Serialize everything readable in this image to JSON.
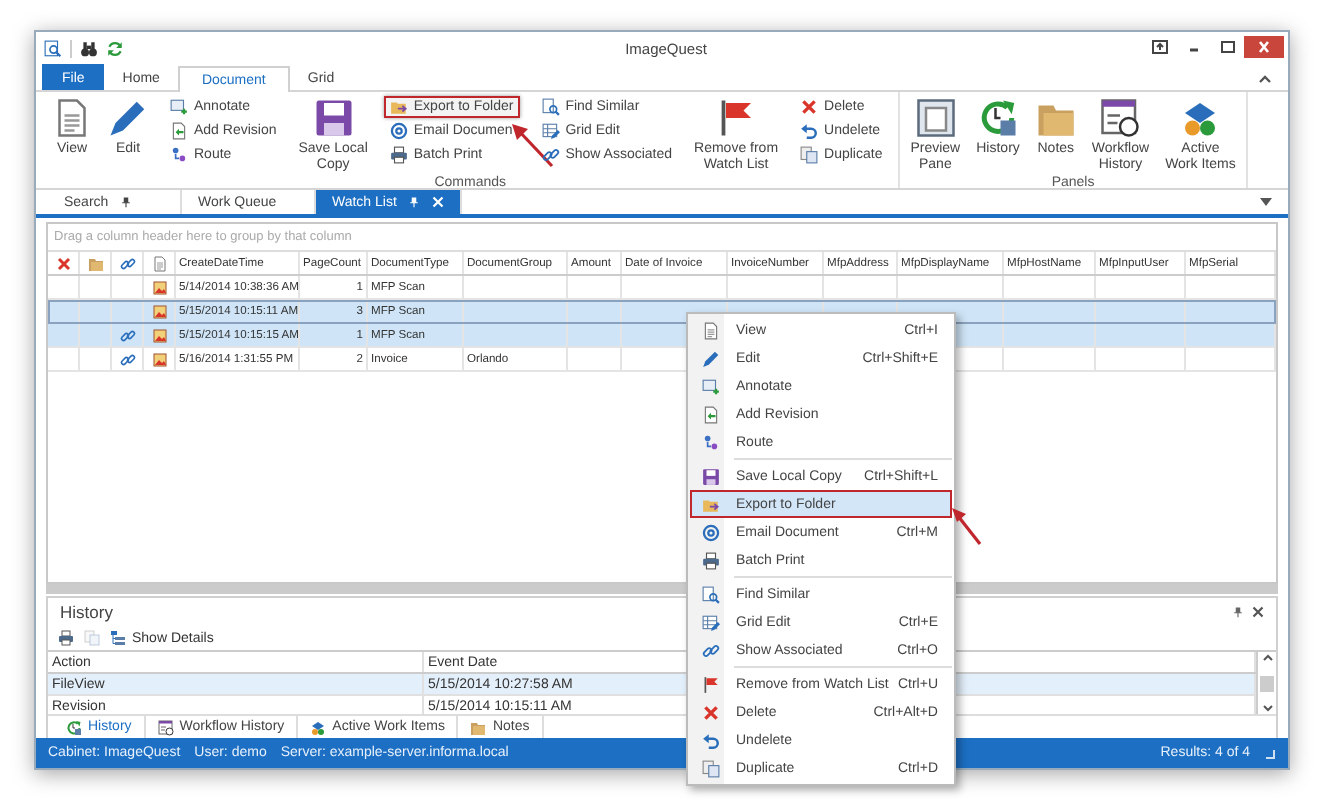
{
  "window": {
    "title": "ImageQuest"
  },
  "ribbon": {
    "tabs": [
      {
        "label": "File",
        "kind": "file",
        "selected": false
      },
      {
        "label": "Home",
        "kind": "page",
        "selected": false
      },
      {
        "label": "Document",
        "kind": "page",
        "selected": true
      },
      {
        "label": "Grid",
        "kind": "page",
        "selected": false
      }
    ],
    "groups": [
      {
        "label": "Commands",
        "items": [
          {
            "kind": "large",
            "label": "View"
          },
          {
            "kind": "large",
            "label": "Edit"
          },
          {
            "kind": "stack",
            "buttons": [
              {
                "label": "Annotate",
                "callout": false
              },
              {
                "label": "Add Revision",
                "callout": false
              },
              {
                "label": "Route",
                "callout": false
              }
            ]
          },
          {
            "kind": "large",
            "label": "Save Local\nCopy"
          },
          {
            "kind": "stack",
            "buttons": [
              {
                "label": "Export to Folder",
                "callout": true
              },
              {
                "label": "Email Documen",
                "callout": false
              },
              {
                "label": "Batch Print",
                "callout": false
              }
            ]
          },
          {
            "kind": "stack",
            "buttons": [
              {
                "label": "Find Similar",
                "callout": false
              },
              {
                "label": "Grid Edit",
                "callout": false
              },
              {
                "label": "Show Associated",
                "callout": false
              }
            ]
          },
          {
            "kind": "large",
            "label": "Remove from\nWatch List"
          },
          {
            "kind": "stack",
            "buttons": [
              {
                "label": "Delete",
                "callout": false
              },
              {
                "label": "Undelete",
                "callout": false
              },
              {
                "label": "Duplicate",
                "callout": false
              }
            ]
          }
        ]
      },
      {
        "label": "Panels",
        "items": [
          {
            "kind": "large",
            "label": "Preview\nPane"
          },
          {
            "kind": "large",
            "label": "History"
          },
          {
            "kind": "large",
            "label": "Notes"
          },
          {
            "kind": "large",
            "label": "Workflow\nHistory"
          },
          {
            "kind": "large",
            "label": "Active\nWork Items"
          }
        ]
      }
    ]
  },
  "doc_tabs": [
    {
      "label": "Search",
      "selected": false,
      "pinned": true
    },
    {
      "label": "Work Queue",
      "selected": false,
      "pinned": false
    },
    {
      "label": "Watch List",
      "selected": true,
      "pinned": true
    }
  ],
  "grid": {
    "group_hint": "Drag a column header here to group by that column",
    "columns": [
      {
        "kind": "icon"
      },
      {
        "kind": "icon"
      },
      {
        "kind": "icon"
      },
      {
        "kind": "icon"
      },
      {
        "kind": "text",
        "label": "CreateDateTime"
      },
      {
        "kind": "text",
        "label": "PageCount"
      },
      {
        "kind": "text",
        "label": "DocumentType"
      },
      {
        "kind": "text",
        "label": "DocumentGroup"
      },
      {
        "kind": "text",
        "label": "Amount"
      },
      {
        "kind": "text",
        "label": "Date of Invoice"
      },
      {
        "kind": "text",
        "label": "InvoiceNumber"
      },
      {
        "kind": "text",
        "label": "MfpAddress"
      },
      {
        "kind": "text",
        "label": "MfpDisplayName"
      },
      {
        "kind": "text",
        "label": "MfpHostName"
      },
      {
        "kind": "text",
        "label": "MfpInputUser"
      },
      {
        "kind": "text",
        "label": "MfpSerial"
      }
    ],
    "rows": [
      {
        "selected": false,
        "focused": false,
        "linked": false,
        "cells": [
          "5/14/2014 10:38:36 AM",
          "1",
          "MFP Scan"
        ]
      },
      {
        "selected": true,
        "focused": true,
        "linked": false,
        "cells": [
          "5/15/2014 10:15:11 AM",
          "3",
          "MFP Scan"
        ]
      },
      {
        "selected": true,
        "focused": false,
        "linked": true,
        "cells": [
          "5/15/2014 10:15:15 AM",
          "1",
          "MFP Scan"
        ]
      },
      {
        "selected": false,
        "focused": false,
        "linked": true,
        "cells": [
          "5/16/2014 1:31:55 PM",
          "2",
          "Invoice",
          "Orlando"
        ]
      }
    ]
  },
  "context_menu": {
    "groups": [
      {
        "items": [
          {
            "label": "View",
            "shortcut": "Ctrl+I",
            "hovered": false,
            "callout": false
          },
          {
            "label": "Edit",
            "shortcut": "Ctrl+Shift+E",
            "hovered": false,
            "callout": false
          },
          {
            "label": "Annotate",
            "hovered": false,
            "callout": false
          },
          {
            "label": "Add Revision",
            "hovered": false,
            "callout": false
          },
          {
            "label": "Route",
            "hovered": false,
            "callout": false
          }
        ]
      },
      {
        "items": [
          {
            "label": "Save Local Copy",
            "shortcut": "Ctrl+Shift+L",
            "hovered": false,
            "callout": false
          },
          {
            "label": "Export to Folder",
            "hovered": true,
            "callout": true
          },
          {
            "label": "Email Document",
            "shortcut": "Ctrl+M",
            "hovered": false,
            "callout": false
          },
          {
            "label": "Batch Print",
            "hovered": false,
            "callout": false
          }
        ]
      },
      {
        "items": [
          {
            "label": "Find Similar",
            "hovered": false,
            "callout": false
          },
          {
            "label": "Grid Edit",
            "shortcut": "Ctrl+E",
            "hovered": false,
            "callout": false
          },
          {
            "label": "Show Associated",
            "shortcut": "Ctrl+O",
            "hovered": false,
            "callout": false
          }
        ]
      },
      {
        "items": [
          {
            "label": "Remove from Watch List",
            "shortcut": "Ctrl+U",
            "hovered": false,
            "callout": false
          },
          {
            "label": "Delete",
            "shortcut": "Ctrl+Alt+D",
            "hovered": false,
            "callout": false
          },
          {
            "label": "Undelete",
            "hovered": false,
            "callout": false
          },
          {
            "label": "Duplicate",
            "shortcut": "Ctrl+D",
            "hovered": false,
            "callout": false
          }
        ]
      }
    ]
  },
  "history": {
    "title": "History",
    "show_details": "Show Details",
    "columns": [
      "Action",
      "Event Date"
    ],
    "rows": [
      {
        "selected": true,
        "cells": [
          "FileView",
          "5/15/2014 10:27:58 AM"
        ]
      },
      {
        "selected": false,
        "cells": [
          "Revision",
          "5/15/2014 10:15:11 AM"
        ]
      }
    ],
    "tabs": [
      {
        "label": "History",
        "selected": true
      },
      {
        "label": "Workflow History",
        "selected": false
      },
      {
        "label": "Active Work Items",
        "selected": false
      },
      {
        "label": "Notes",
        "selected": false
      }
    ]
  },
  "status_bar": {
    "cabinet": "Cabinet: ImageQuest",
    "user": "User: demo",
    "server": "Server: example-server.informa.local",
    "results": "Results: 4 of 4"
  }
}
